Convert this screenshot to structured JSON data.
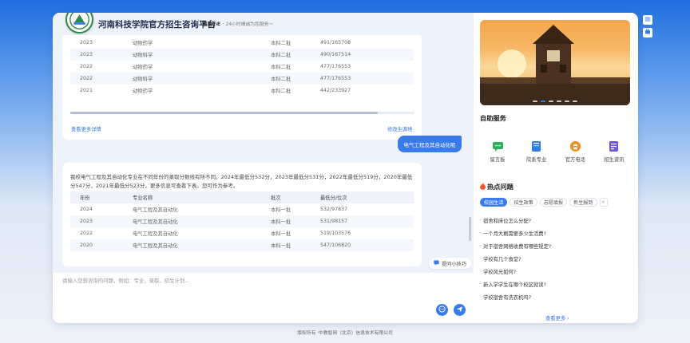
{
  "header": {
    "title": "河南科技学院官方招生咨询平台",
    "bot_name": "豫易小E",
    "slogan": "· 24小时竭诚为您服务～"
  },
  "prev_table": {
    "rows": [
      {
        "year": "2023",
        "major": "动物药学",
        "batch": "本科二批",
        "score": "491/165708"
      },
      {
        "year": "2023",
        "major": "动物科学",
        "batch": "本科二批",
        "score": "490/167514"
      },
      {
        "year": "2022",
        "major": "动物药学",
        "batch": "本科二批",
        "score": "477/176553"
      },
      {
        "year": "2022",
        "major": "动物科学",
        "batch": "本科二批",
        "score": "477/176553"
      },
      {
        "year": "2021",
        "major": "动物药学",
        "batch": "本科二批",
        "score": "442/233927"
      }
    ],
    "more_link": "查看更多详情",
    "change_region": "修改生源地"
  },
  "user_message": "电气工程及其自动化呢",
  "answer": {
    "text": "我校电气工程及其自动化专业在不同年份的录取分数线有所不同。2024年最低分532分，2023年最低分531分，2022年最低分519分，2020年最低分547分，2021年最低分523分，更多信息可查看下表。您可作为参考。",
    "columns": [
      "年份",
      "专业名称",
      "批次",
      "最低分/位次"
    ],
    "rows": [
      {
        "year": "2024",
        "major": "电气工程及其自动化",
        "batch": "本科一批",
        "score": "532/97837"
      },
      {
        "year": "2023",
        "major": "电气工程及其自动化",
        "batch": "本科一批",
        "score": "531/98157"
      },
      {
        "year": "2022",
        "major": "电气工程及其自动化",
        "batch": "本科一批",
        "score": "519/103576"
      },
      {
        "year": "2020",
        "major": "电气工程及其自动化",
        "batch": "本科一批",
        "score": "547/106820"
      }
    ]
  },
  "tips_label": "提问小技巧",
  "input": {
    "placeholder": "请输入您想咨询的问题，例如：专业、录取、招生计划..."
  },
  "self_service": {
    "title": "自助服务",
    "items": [
      {
        "label": "留言板",
        "icon": "message-board-icon",
        "color": "#2fae5b"
      },
      {
        "label": "院系专业",
        "icon": "book-icon",
        "color": "#2f7ee9"
      },
      {
        "label": "官方电话",
        "icon": "phone-icon",
        "color": "#f08a1c"
      },
      {
        "label": "招生资讯",
        "icon": "news-icon",
        "color": "#6a5ae0"
      }
    ]
  },
  "hot": {
    "title": "热点问题",
    "tabs": [
      {
        "label": "校园生活",
        "active": true
      },
      {
        "label": "招生政策",
        "active": false
      },
      {
        "label": "志愿填报",
        "active": false
      },
      {
        "label": "新生报到",
        "active": false
      }
    ],
    "questions": [
      "宿舍和床位怎么分配?",
      "一个月大概需要多少生活费?",
      "对于宿舍网络收费有哪些规定?",
      "学校有几个食堂?",
      "学校风光如何?",
      "新入学学生在哪个校区就读?",
      "学校宿舍有洗衣机吗?"
    ],
    "more": "查看更多 ›"
  },
  "footer": "版权所有 ·中教智网（北京）信息技术有限公司",
  "colors": {
    "accent": "#3a7bec",
    "fire": "#f0522b"
  }
}
